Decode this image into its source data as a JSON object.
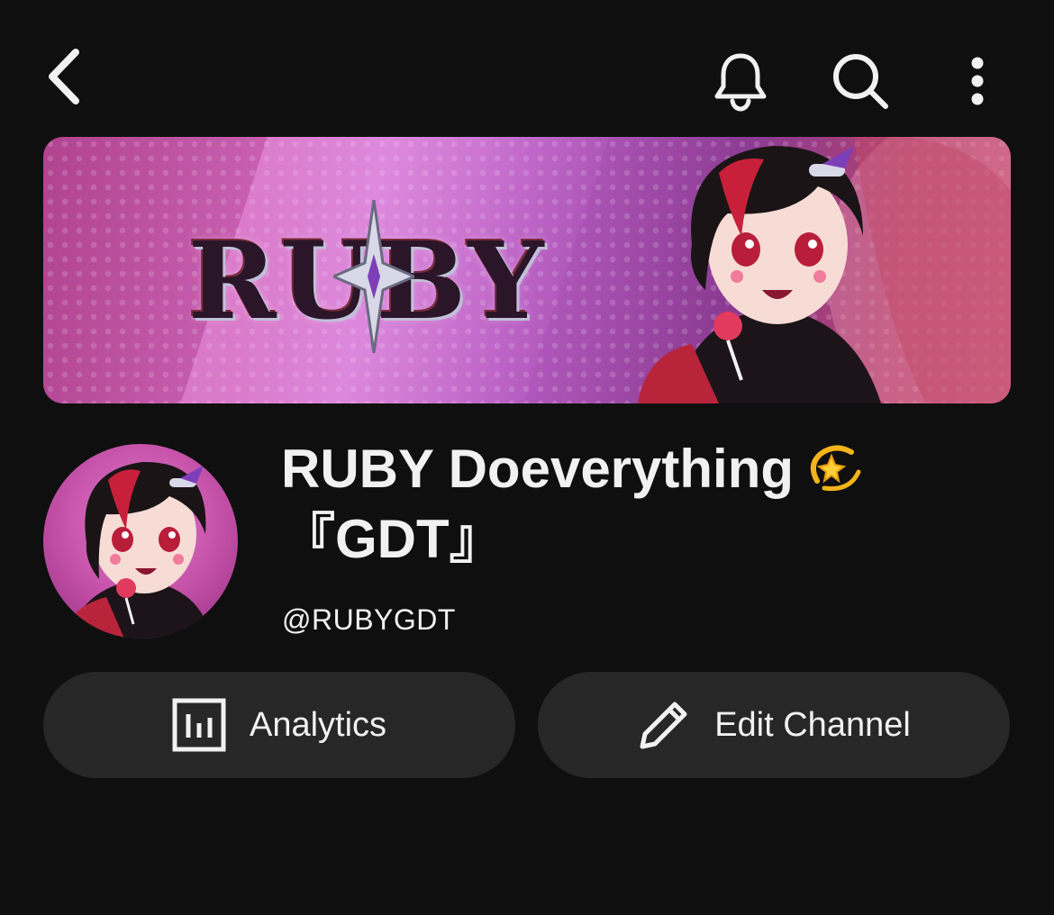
{
  "topbar": {
    "back_icon": "chevron-left-icon",
    "notification_icon": "bell-icon",
    "search_icon": "search-icon",
    "more_icon": "more-vertical-icon"
  },
  "banner": {
    "logo_text": "RUBY"
  },
  "channel": {
    "name": "RUBY Doeverything",
    "name_emoji": "💫",
    "name_line2": "『GDT』",
    "handle": "@RUBYGDT"
  },
  "actions": {
    "analytics_label": "Analytics",
    "analytics_icon": "analytics-icon",
    "edit_label": "Edit Channel",
    "edit_icon": "pencil-icon"
  },
  "colors": {
    "background": "#0f0f0f",
    "button_bg": "#272727",
    "text": "#f1f1f1",
    "banner_accent": "#c85fb1"
  }
}
